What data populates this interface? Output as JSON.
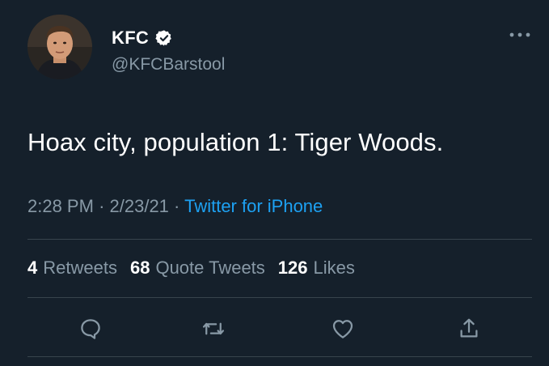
{
  "tweet": {
    "display_name": "KFC",
    "handle": "@KFCBarstool",
    "text": "Hoax city, population 1: Tiger Woods.",
    "time": "2:28 PM",
    "date": "2/23/21",
    "separator": "·",
    "source": "Twitter for iPhone"
  },
  "stats": {
    "retweets_count": "4",
    "retweets_label": "Retweets",
    "quotes_count": "68",
    "quotes_label": "Quote Tweets",
    "likes_count": "126",
    "likes_label": "Likes"
  },
  "icons": {
    "verified": "verified-badge-icon",
    "more": "more-options-icon",
    "reply": "reply-icon",
    "retweet": "retweet-icon",
    "like": "heart-icon",
    "share": "share-icon"
  },
  "colors": {
    "background": "#15202b",
    "secondary_text": "#8899a6",
    "link": "#1da1f2",
    "divider": "#38444d"
  }
}
